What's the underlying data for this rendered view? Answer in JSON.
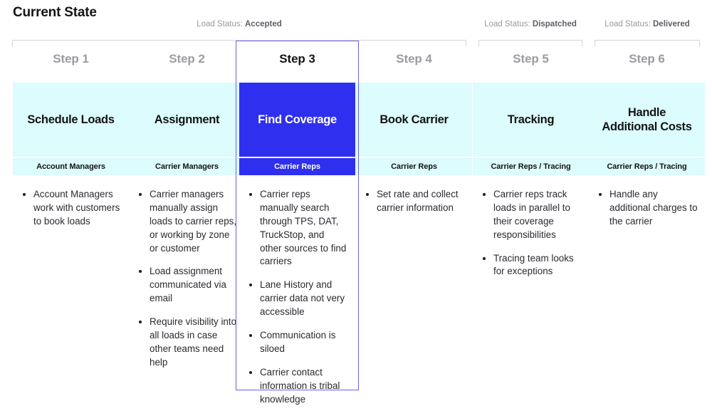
{
  "page": {
    "title": "Current State"
  },
  "theme": {
    "card_bg": "#dcfcfd",
    "active_card_bg": "#2f2ff0",
    "highlight_border": "#6a63e8",
    "arrow_color": "#3333e0",
    "bracket_color": "#d6d6da",
    "step_label_color": "#9b9ba1"
  },
  "status_groups": [
    {
      "prefix": "Load Status:",
      "value": "Accepted"
    },
    {
      "prefix": "Load Status:",
      "value": "Dispatched"
    },
    {
      "prefix": "Load Status:",
      "value": "Delivered"
    }
  ],
  "columns": [
    {
      "step": "Step 1",
      "title": "Schedule Loads",
      "role": "Account Managers",
      "active": false,
      "bullets": [
        "Account Managers work with customers to book loads"
      ]
    },
    {
      "step": "Step 2",
      "title": "Assignment",
      "role": "Carrier Managers",
      "active": false,
      "bullets": [
        "Carrier managers manually assign loads to carrier reps, or working by zone or customer",
        "Load assignment communicated via email",
        "Require visibility into all loads in case other teams need help"
      ]
    },
    {
      "step": "Step 3",
      "title": "Find Coverage",
      "role": "Carrier Reps",
      "active": true,
      "bullets": [
        "Carrier reps manually search through TPS, DAT, TruckStop, and other sources to find carriers",
        "Lane History and carrier data not very accessible",
        "Communication is siloed",
        "Carrier contact information is tribal knowledge"
      ]
    },
    {
      "step": "Step 4",
      "title": "Book Carrier",
      "role": "Carrier Reps",
      "active": false,
      "bullets": [
        "Set rate and collect carrier information"
      ]
    },
    {
      "step": "Step 5",
      "title": "Tracking",
      "role": "Carrier Reps / Tracing",
      "active": false,
      "bullets": [
        "Carrier reps track loads in parallel to their coverage responsibilities",
        "Tracing team looks for exceptions"
      ]
    },
    {
      "step": "Step 6",
      "title": "Handle\nAdditional Costs",
      "role": "Carrier Reps / Tracing",
      "active": false,
      "bullets": [
        "Handle any additional charges to the carrier"
      ]
    }
  ]
}
